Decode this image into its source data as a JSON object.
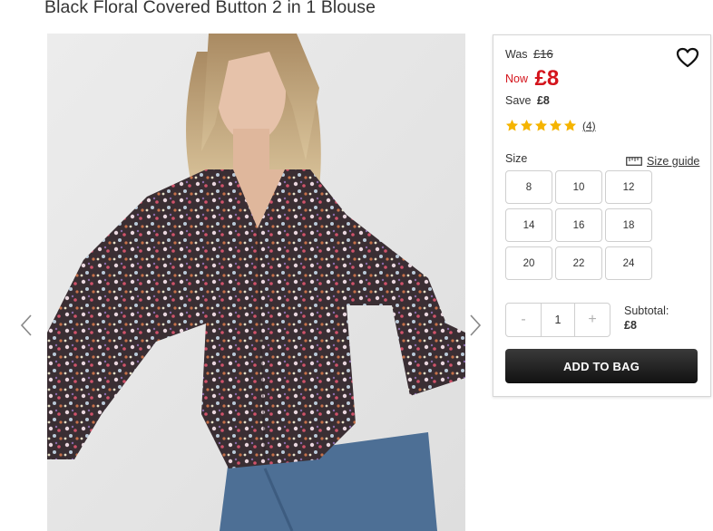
{
  "product": {
    "title": "Black Floral Covered Button 2 in 1 Blouse"
  },
  "pricing": {
    "was_label": "Was",
    "was_price": "£16",
    "now_label": "Now",
    "now_price": "£8",
    "save_label": "Save",
    "save_amount": "£8",
    "accent_color": "#d4141c"
  },
  "rating": {
    "stars": 5,
    "count": "(4)",
    "star_color": "#f5b400"
  },
  "size": {
    "label": "Size",
    "guide_label": "Size guide",
    "guide_icon": "ruler-icon",
    "options": [
      "8",
      "10",
      "12",
      "14",
      "16",
      "18",
      "20",
      "22",
      "24"
    ]
  },
  "quantity": {
    "minus": "-",
    "value": "1",
    "plus": "+"
  },
  "subtotal": {
    "label": "Subtotal:",
    "amount": "£8"
  },
  "cart": {
    "add_label": "ADD TO BAG"
  },
  "icons": {
    "wishlist": "heart-icon",
    "prev": "chevron-left-icon",
    "next": "chevron-right-icon"
  }
}
